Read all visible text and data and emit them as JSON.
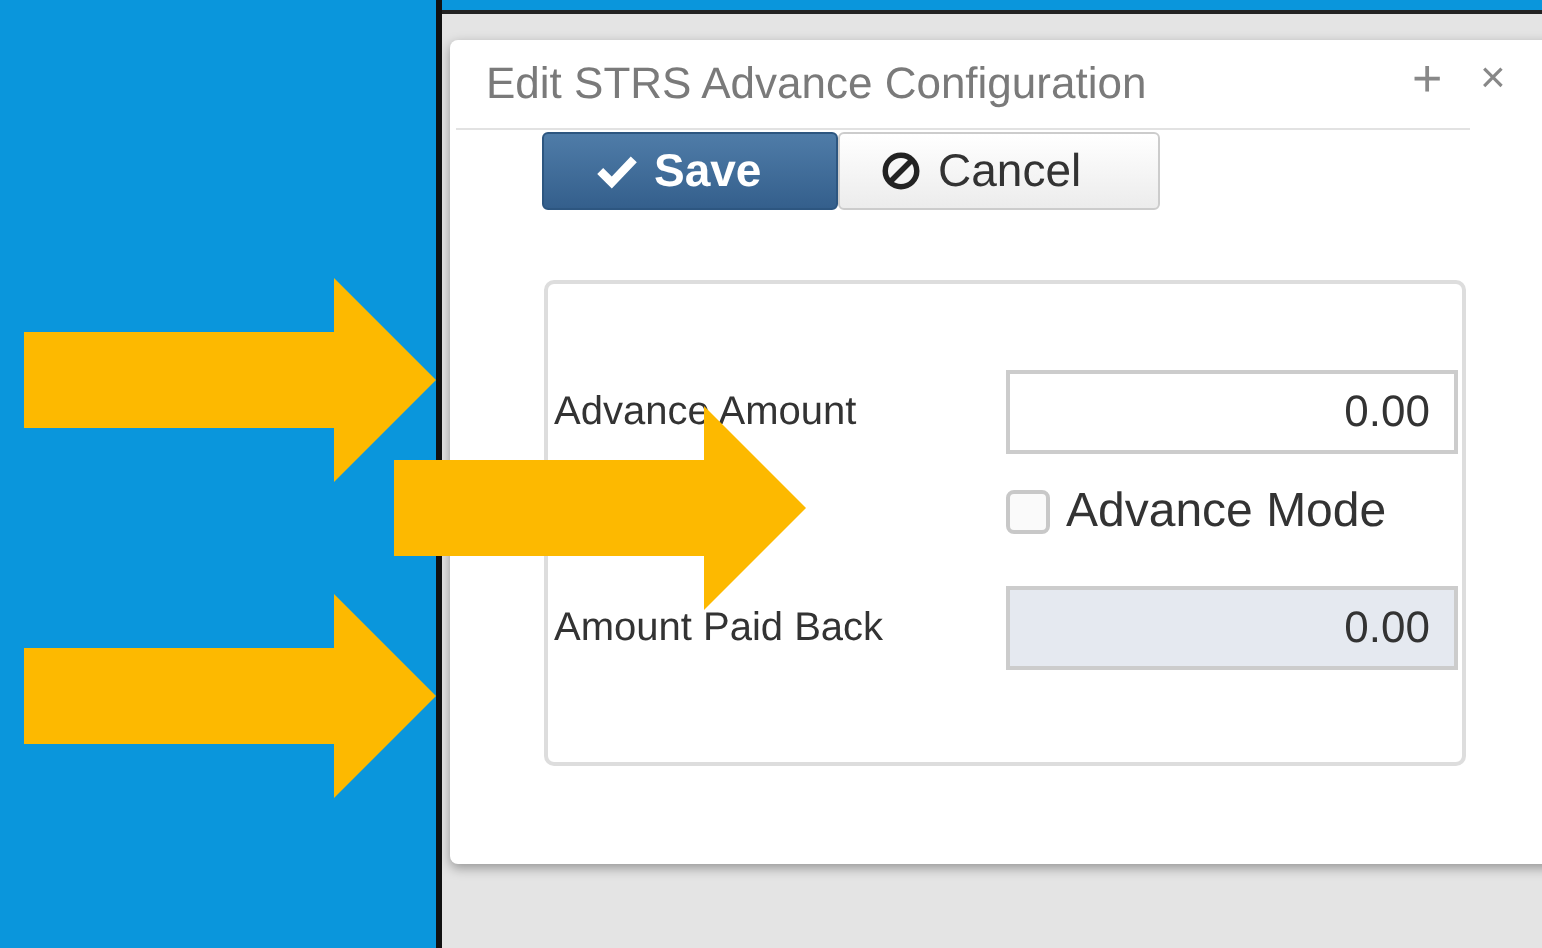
{
  "dialog": {
    "title": "Edit STRS Advance Configuration",
    "title_buttons": [
      "+",
      "×"
    ]
  },
  "buttons": [
    {
      "kind": "primary",
      "label": "Save"
    },
    {
      "kind": "default",
      "label": "Cancel"
    }
  ],
  "fields": [
    {
      "kind": "input",
      "label": "Advance Amount",
      "value": "0.00",
      "disabled": false
    },
    {
      "kind": "checkbox",
      "label": "Advance Mode",
      "checked": false
    },
    {
      "kind": "input",
      "label": "Amount Paid Back",
      "value": "0.00",
      "disabled": true
    }
  ]
}
